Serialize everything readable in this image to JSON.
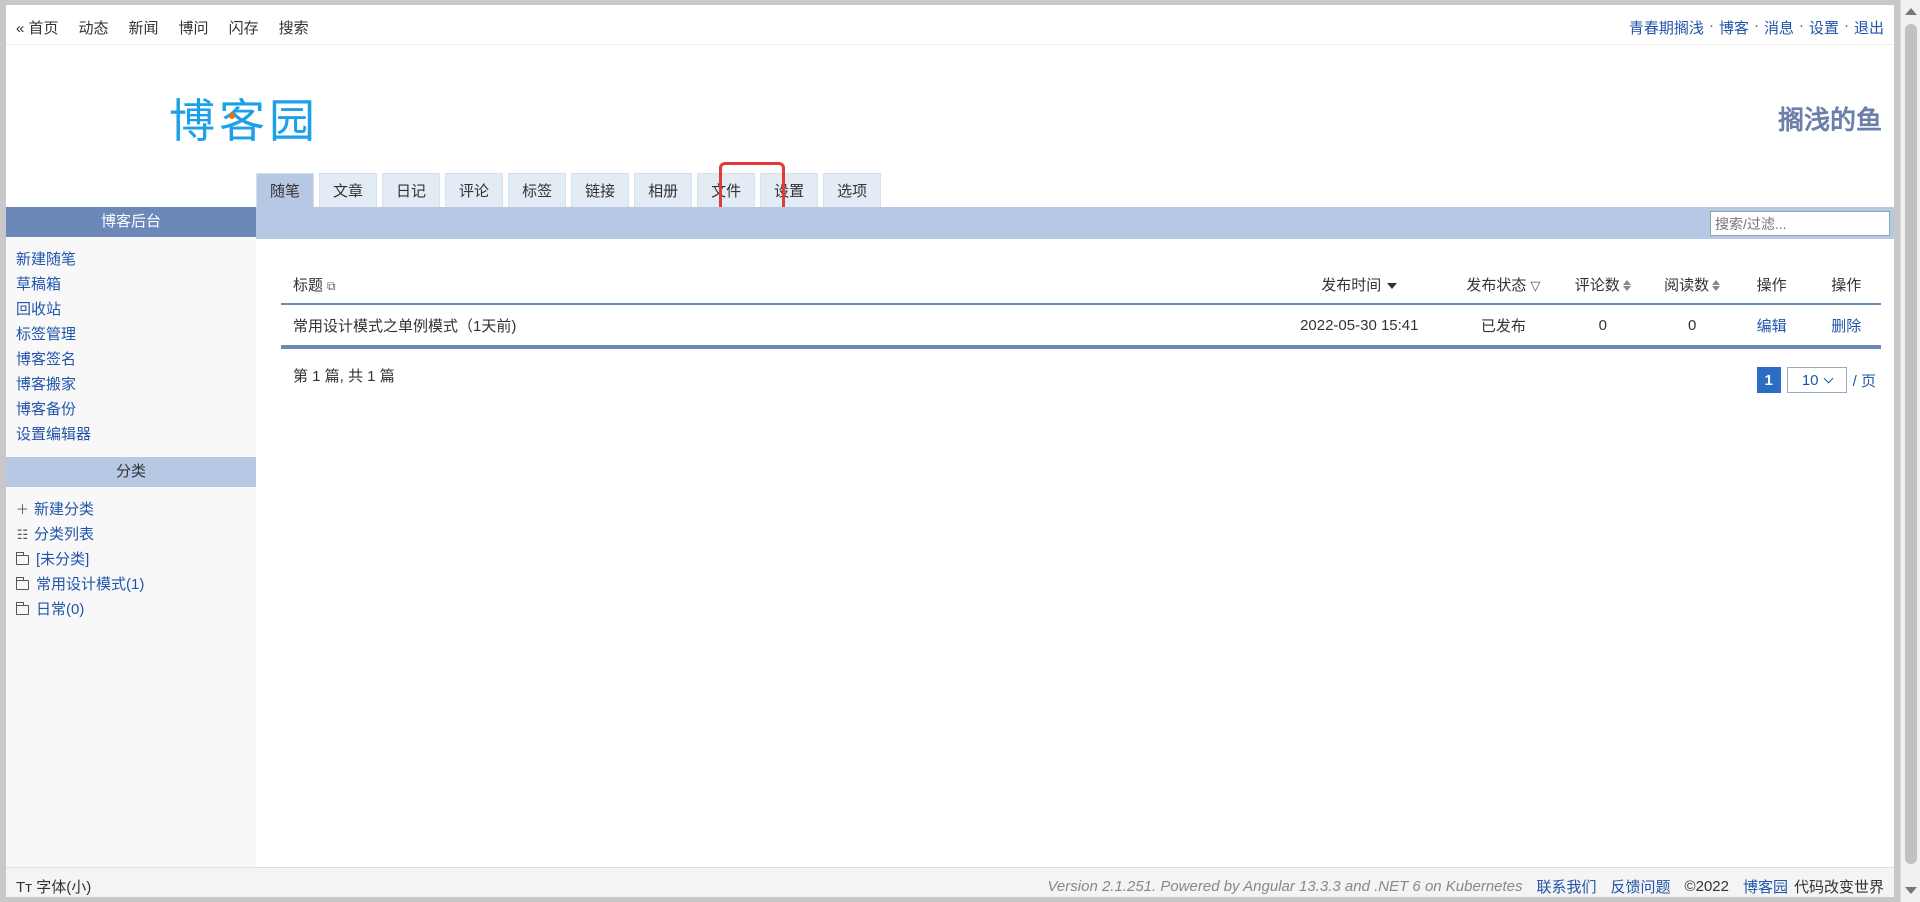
{
  "topnav": {
    "items": [
      "« 首页",
      "动态",
      "新闻",
      "博问",
      "闪存",
      "搜索"
    ],
    "user": "青春期搁浅",
    "links": [
      "博客",
      "消息",
      "设置",
      "退出"
    ],
    "separator": "·"
  },
  "header": {
    "logo": "博客园",
    "blog_title": "搁浅的鱼"
  },
  "tabs": [
    "随笔",
    "文章",
    "日记",
    "评论",
    "标签",
    "链接",
    "相册",
    "文件",
    "设置",
    "选项"
  ],
  "search": {
    "placeholder": "搜索/过滤..."
  },
  "sidebar": {
    "admin_heading": "博客后台",
    "admin_items": [
      "新建随笔",
      "草稿箱",
      "回收站",
      "标签管理",
      "博客签名",
      "博客搬家",
      "博客备份",
      "设置编辑器"
    ],
    "category_heading": "分类",
    "category_actions": [
      {
        "icon": "plus-icon",
        "label": "新建分类"
      },
      {
        "icon": "list-icon",
        "label": "分类列表"
      }
    ],
    "categories": [
      "[未分类]",
      "常用设计模式(1)",
      "日常(0)"
    ]
  },
  "table": {
    "headers": {
      "title": "标题",
      "time": "发布时间",
      "status": "发布状态",
      "comments": "评论数",
      "views": "阅读数",
      "op1": "操作",
      "op2": "操作"
    },
    "rows": [
      {
        "title": "常用设计模式之单例模式（1天前)",
        "time": "2022-05-30 15:41",
        "status": "已发布",
        "comments": "0",
        "views": "0",
        "edit": "编辑",
        "delete": "删除"
      }
    ]
  },
  "summary": "第 1 篇, 共 1 篇",
  "pager": {
    "current": "1",
    "page_size": "10",
    "per_page": "/ 页"
  },
  "footer": {
    "font_toggle": "Tт 字体(小)",
    "version": "Version 2.1.251. Powered by Angular 13.3.3 and .NET 6 on Kubernetes",
    "contact": "联系我们",
    "feedback": "反馈问题",
    "copyright": "©2022",
    "site": "博客园",
    "slogan": "代码改变世界"
  },
  "colors": {
    "accent": "#6b88b8",
    "link": "#2255aa",
    "highlight_border": "#e53935",
    "logo": "#1ca1e8"
  }
}
